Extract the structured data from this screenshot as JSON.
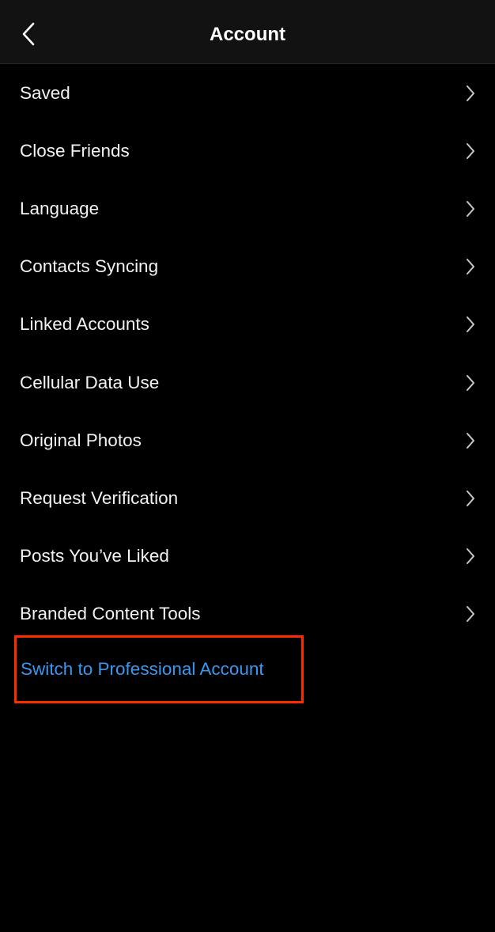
{
  "header": {
    "title": "Account",
    "back_icon": "chevron-left-icon"
  },
  "menu": {
    "items": [
      {
        "label": "Saved",
        "icon": "chevron-right-icon"
      },
      {
        "label": "Close Friends",
        "icon": "chevron-right-icon"
      },
      {
        "label": "Language",
        "icon": "chevron-right-icon"
      },
      {
        "label": "Contacts Syncing",
        "icon": "chevron-right-icon"
      },
      {
        "label": "Linked Accounts",
        "icon": "chevron-right-icon"
      },
      {
        "label": "Cellular Data Use",
        "icon": "chevron-right-icon"
      },
      {
        "label": "Original Photos",
        "icon": "chevron-right-icon"
      },
      {
        "label": "Request Verification",
        "icon": "chevron-right-icon"
      },
      {
        "label": "Posts You’ve Liked",
        "icon": "chevron-right-icon"
      },
      {
        "label": "Branded Content Tools",
        "icon": "chevron-right-icon"
      }
    ]
  },
  "professional": {
    "label": "Switch to Professional Account",
    "color": "#3897f0",
    "highlight_color": "#ff2a00"
  }
}
